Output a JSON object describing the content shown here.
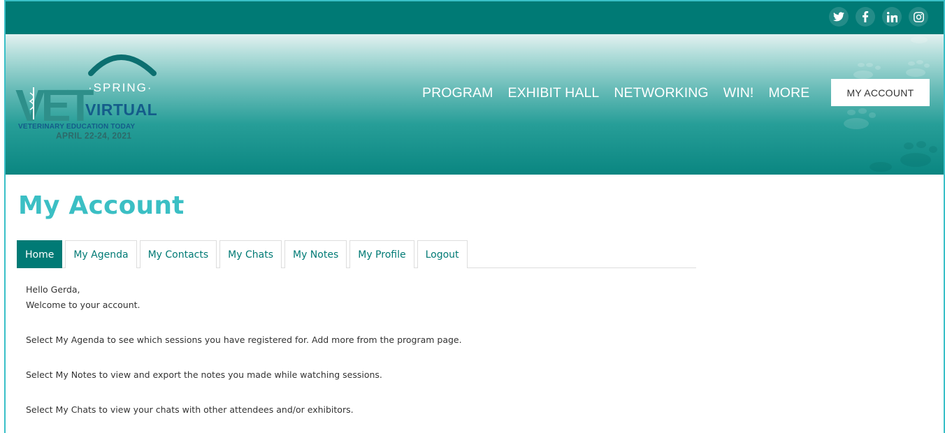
{
  "social": {
    "icons": [
      "twitter-icon",
      "facebook-icon",
      "linkedin-icon",
      "instagram-icon"
    ]
  },
  "logo": {
    "vet": "VET",
    "spring": "SPRING",
    "virtual": "VIRTUAL",
    "subtitle": "VETERINARY EDUCATION TODAY",
    "date": "APRIL 22-24, 2021"
  },
  "nav": {
    "items": [
      "PROGRAM",
      "EXHIBIT HALL",
      "NETWORKING",
      "WIN!",
      "MORE"
    ],
    "account_label": "MY ACCOUNT"
  },
  "page": {
    "title": "My Account"
  },
  "tabs": [
    "Home",
    "My Agenda",
    "My Contacts",
    "My Chats",
    "My Notes",
    "My Profile",
    "Logout"
  ],
  "active_tab": "Home",
  "content": {
    "greeting": "Hello Gerda,",
    "welcome": "Welcome to your account.",
    "agenda_info": "Select My Agenda to see which sessions you have registered for. Add more from the program page.",
    "notes_info": "Select My Notes to view and export the notes you made while watching sessions.",
    "chats_info": "Select My Chats to view your chats with other attendees and/or exhibitors."
  },
  "colors": {
    "primary": "#007a75",
    "accent": "#3bbfc4",
    "logo_blue": "#145c8a"
  }
}
